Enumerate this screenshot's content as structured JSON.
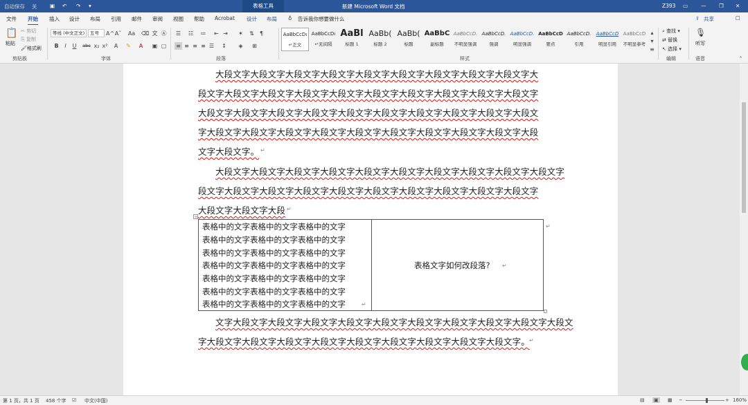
{
  "titlebar": {
    "autosave": "自动保存",
    "toggle": "关",
    "table_tools": "表格工具",
    "title": "新建 Microsoft Word 文档",
    "user": "Z393"
  },
  "tabs": [
    "文件",
    "开始",
    "插入",
    "设计",
    "布局",
    "引用",
    "邮件",
    "审阅",
    "视图",
    "帮助",
    "Acrobat",
    "设计",
    "布局"
  ],
  "tell_me": "告诉我你想要做什么",
  "share": "共享",
  "ribbon": {
    "clipboard": {
      "paste": "粘贴",
      "cut": "剪切",
      "copy": "复制",
      "format_painter": "格式刷",
      "label": "剪贴板"
    },
    "font": {
      "name": "等线 (中文正文)",
      "size": "五号",
      "label": "字体",
      "bold": "B",
      "italic": "I",
      "underline": "U",
      "strike": "abc",
      "sub": "x₂",
      "sup": "x²",
      "grow": "A^",
      "shrink": "Aˇ",
      "case": "Aa"
    },
    "paragraph": {
      "label": "段落"
    },
    "styles": {
      "label": "样式",
      "items": [
        {
          "preview": "AaBbCcDı",
          "name": "↵正文"
        },
        {
          "preview": "AaBbCcDı",
          "name": "↵无间隔"
        },
        {
          "preview": "AaBl",
          "name": "标题 1"
        },
        {
          "preview": "AaBb(",
          "name": "标题 2"
        },
        {
          "preview": "AaBb(",
          "name": "标题"
        },
        {
          "preview": "AaBbC",
          "name": "副标题"
        },
        {
          "preview": "AaBbCcD.",
          "name": "不明显强调"
        },
        {
          "preview": "AaBbCcD.",
          "name": "强调"
        },
        {
          "preview": "AaBbCcD.",
          "name": "明显强调"
        },
        {
          "preview": "AaBbCcD",
          "name": "要点"
        },
        {
          "preview": "AaBbCcD.",
          "name": "引用"
        },
        {
          "preview": "AaBbCcD",
          "name": "明显引用"
        },
        {
          "preview": "AaBbCcD",
          "name": "不明显参考"
        }
      ]
    },
    "editing": {
      "find": "查找",
      "replace": "替换",
      "select": "选择",
      "label": "编辑"
    },
    "voice": {
      "dictate": "听写",
      "label": "语音"
    }
  },
  "document": {
    "lines": [
      "大段文字大段文字大段文字大段文字大段文字大段文字大段文字大段文字大段文字大",
      "段文字大段文字大段文字大段文字大段文字大段文字大段文字大段文字大段文字大段文字",
      "大段文字大段文字大段文字大段文字大段文字大段文字大段文字大段文字大段文字大段文",
      "字大段文字大段文字大段文字大段文字大段文字大段文字大段文字大段文字大段文字大段",
      "文字大段文字。",
      "大段文字大段文字大段文字大段文字大段文字大段文字大段文字大段文字大段文字大段文字",
      "段文字大段文字大段文字大段文字大段文字大段文字大段文字大段文字大段文字大段文字",
      "大段文字大段文字大段",
      "文字大段文字大段文字大段文字大段文字大段文字大段文字大段文字大段文字大段文字大段文",
      "字大段文字大段文字大段文字大段文字大段文字大段文字大段文字大段文字大段文字。"
    ],
    "table": {
      "left_lines": [
        "表格中的文字表格中的文字表格中的文字",
        "表格中的文字表格中的文字表格中的文字",
        "表格中的文字表格中的文字表格中的文字",
        "表格中的文字表格中的文字表格中的文字",
        "表格中的文字表格中的文字表格中的文字",
        "表格中的文字表格中的文字表格中的文字",
        "表格中的文字表格中的文字表格中的文字"
      ],
      "right": "表格文字如何改段落?"
    }
  },
  "status": {
    "page": "第 1 页，共 1 页",
    "words": "458 个字",
    "lang": "中文(中国)",
    "zoom": "160%"
  }
}
